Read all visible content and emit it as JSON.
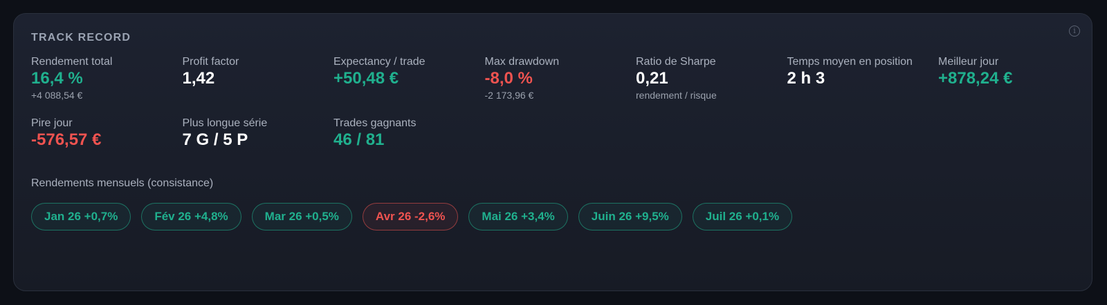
{
  "card": {
    "title": "TRACK RECORD",
    "info_icon": "info-icon"
  },
  "metrics": [
    {
      "id": "rendement-total",
      "label": "Rendement total",
      "value": "16,4 %",
      "sub": "+4 088,54 €",
      "tone": "green"
    },
    {
      "id": "profit-factor",
      "label": "Profit factor",
      "value": "1,42",
      "sub": "",
      "tone": "white"
    },
    {
      "id": "expectancy",
      "label": "Expectancy / trade",
      "value": "+50,48 €",
      "sub": "",
      "tone": "green"
    },
    {
      "id": "max-drawdown",
      "label": "Max drawdown",
      "value": "-8,0 %",
      "sub": "-2 173,96 €",
      "tone": "red"
    },
    {
      "id": "sharpe",
      "label": "Ratio de Sharpe",
      "value": "0,21",
      "sub": "rendement / risque",
      "tone": "white"
    },
    {
      "id": "temps-moyen",
      "label": "Temps moyen en position",
      "value": "2 h 3",
      "sub": "",
      "tone": "white"
    },
    {
      "id": "meilleur-jour",
      "label": "Meilleur jour",
      "value": "+878,24 €",
      "sub": "",
      "tone": "green"
    },
    {
      "id": "pire-jour",
      "label": "Pire jour",
      "value": "-576,57 €",
      "sub": "",
      "tone": "red"
    },
    {
      "id": "plus-longue-serie",
      "label": "Plus longue série",
      "value": "7 G / 5 P",
      "sub": "",
      "tone": "white"
    },
    {
      "id": "trades-gagnants",
      "label": "Trades gagnants",
      "value": "46 / 81",
      "sub": "",
      "tone": "green"
    }
  ],
  "monthly": {
    "label": "Rendements mensuels (consistance)",
    "pills": [
      {
        "text": "Jan 26 +0,7%",
        "tone": "positive"
      },
      {
        "text": "Fév 26 +4,8%",
        "tone": "positive"
      },
      {
        "text": "Mar 26 +0,5%",
        "tone": "positive"
      },
      {
        "text": "Avr 26 -2,6%",
        "tone": "negative"
      },
      {
        "text": "Mai 26 +3,4%",
        "tone": "positive"
      },
      {
        "text": "Juin 26 +9,5%",
        "tone": "positive"
      },
      {
        "text": "Juil 26 +0,1%",
        "tone": "positive"
      }
    ]
  },
  "colors": {
    "positive": "#20b08e",
    "negative": "#ef5350",
    "card_bg": "#1b202c",
    "page_bg": "#0d1017"
  }
}
